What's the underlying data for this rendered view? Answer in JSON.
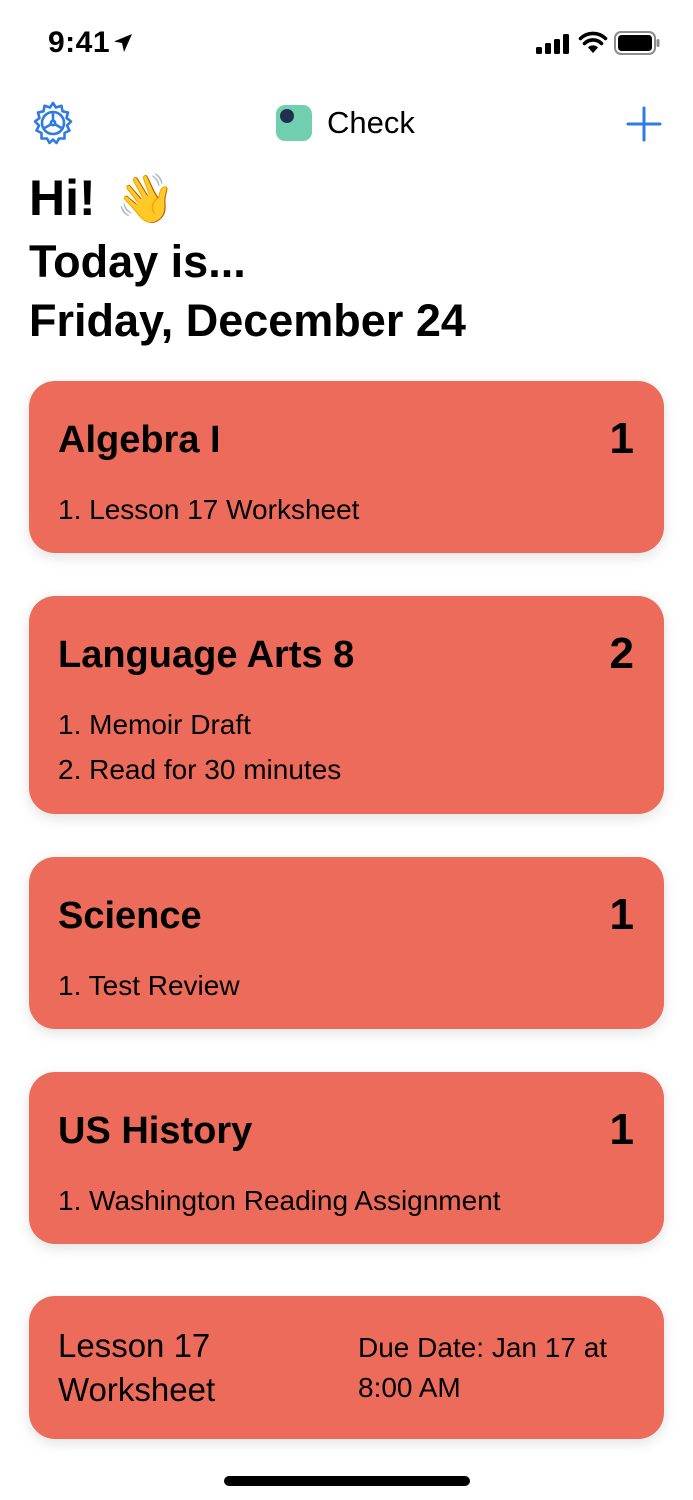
{
  "status_bar": {
    "time": "9:41"
  },
  "nav": {
    "app_name": "Check",
    "accent_color": "#2f7ae5",
    "settings_icon": "gear-icon",
    "add_icon": "plus-icon"
  },
  "header": {
    "greeting": "Hi!",
    "greeting_emoji": "👋",
    "today_label": "Today is...",
    "date": "Friday, December 24"
  },
  "card_color": "#ec6b5a",
  "courses": [
    {
      "name": "Algebra I",
      "count": "1",
      "items": [
        "1. Lesson 17 Worksheet"
      ]
    },
    {
      "name": "Language Arts 8",
      "count": "2",
      "items": [
        "1. Memoir Draft",
        "2. Read for 30 minutes"
      ]
    },
    {
      "name": "Science",
      "count": "1",
      "items": [
        "1. Test Review"
      ]
    },
    {
      "name": "US History",
      "count": "1",
      "items": [
        "1. Washington Reading Assignment"
      ]
    }
  ],
  "detail": {
    "assignment": "Lesson 17 Worksheet",
    "due": "Due Date: Jan 17 at 8:00 AM"
  }
}
